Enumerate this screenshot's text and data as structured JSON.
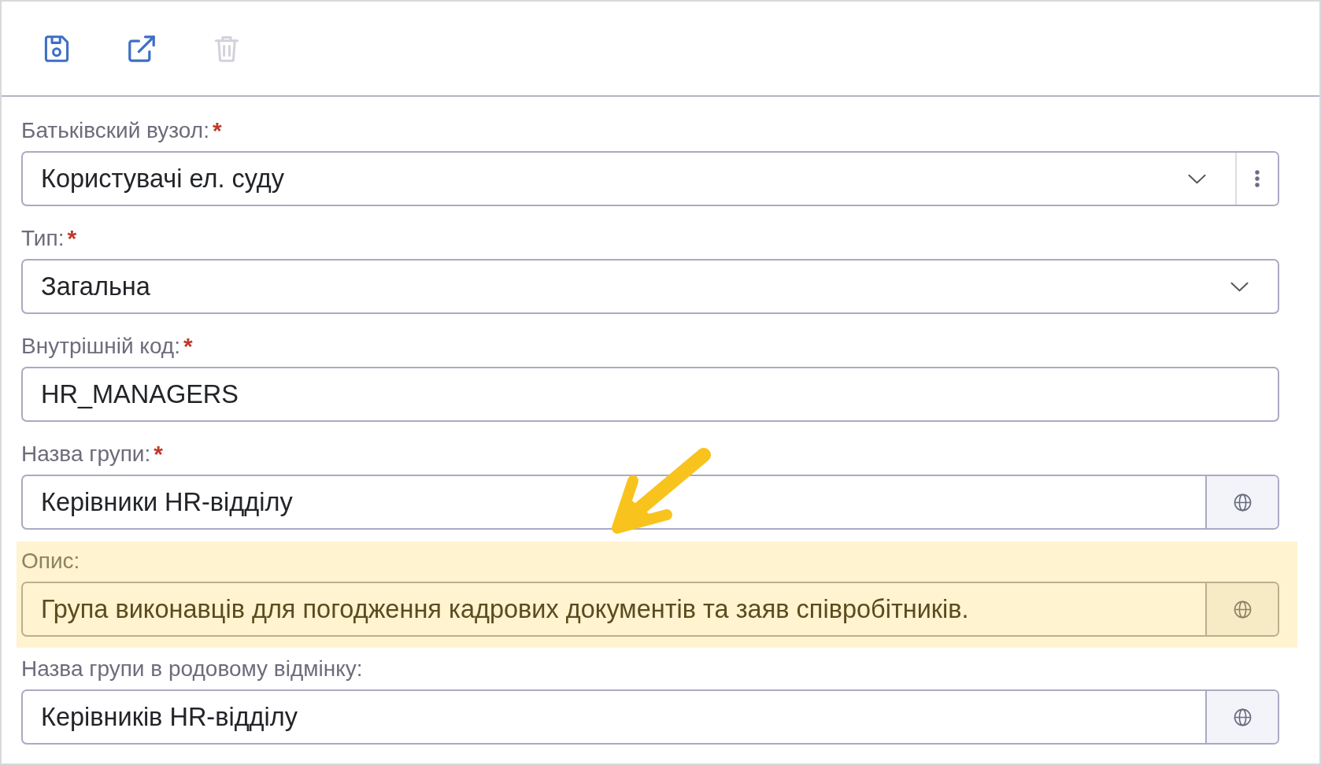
{
  "toolbar": {
    "buttons": [
      {
        "kind": "save",
        "disabled": false
      },
      {
        "kind": "open-external",
        "disabled": false
      },
      {
        "kind": "delete",
        "disabled": true
      }
    ]
  },
  "form": {
    "fields": [
      {
        "label": "Батьківский вузол:",
        "required_mark": "*",
        "kind": "combo",
        "value": "Користувачі ел. суду",
        "highlighted": false
      },
      {
        "label": "Тип:",
        "required_mark": "*",
        "kind": "select",
        "value": "Загальна",
        "highlighted": false
      },
      {
        "label": "Внутрішній код:",
        "required_mark": "*",
        "kind": "text",
        "value": "HR_MANAGERS",
        "highlighted": false
      },
      {
        "label": "Назва групи:",
        "required_mark": "*",
        "kind": "translatable",
        "value": "Керівники HR-відділу",
        "highlighted": false
      },
      {
        "label": "Опис:",
        "kind": "translatable",
        "value": "Група виконавців для погодження кадрових документів та заяв співробітників.",
        "highlighted": true
      },
      {
        "label": "Назва групи в родовому відмінку:",
        "kind": "translatable",
        "value": "Керівників HR-відділу",
        "highlighted": false
      }
    ]
  }
}
